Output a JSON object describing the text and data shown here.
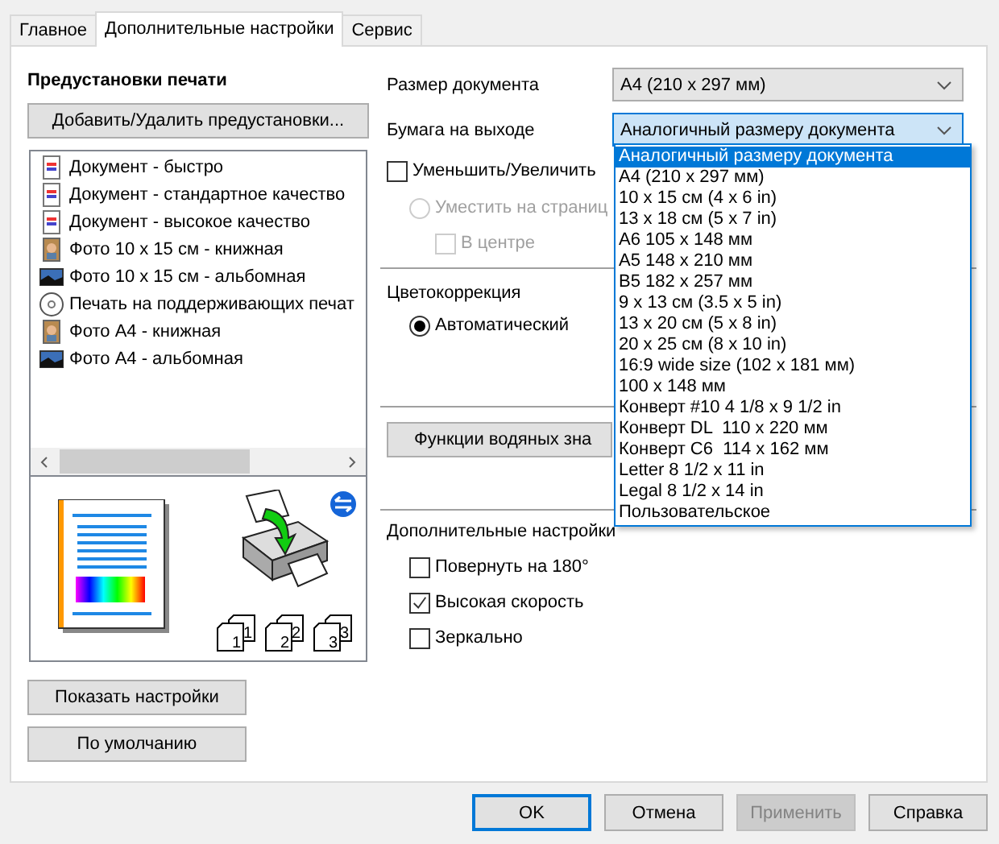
{
  "tabs": [
    {
      "label": "Главное",
      "selected": false
    },
    {
      "label": "Дополнительные настройки",
      "selected": true
    },
    {
      "label": "Сервис",
      "selected": false
    }
  ],
  "presets": {
    "title": "Предустановки печати",
    "add_button": "Добавить/Удалить предустановки...",
    "items": [
      {
        "label": "Документ - быстро",
        "kind": "doc"
      },
      {
        "label": "Документ - стандартное качество",
        "kind": "doc"
      },
      {
        "label": "Документ - высокое качество",
        "kind": "doc"
      },
      {
        "label": "Фото 10 x 15 см - книжная",
        "kind": "portrait"
      },
      {
        "label": "Фото 10 x 15 см - альбомная",
        "kind": "landscape"
      },
      {
        "label": "Печать на поддерживающих печат",
        "kind": "disc"
      },
      {
        "label": "Фото A4 - книжная",
        "kind": "portrait"
      },
      {
        "label": "Фото A4 - альбомная",
        "kind": "landscape"
      }
    ]
  },
  "preview": {
    "collate": [
      {
        "front": "1",
        "back": "1"
      },
      {
        "front": "2",
        "back": "2"
      },
      {
        "front": "3",
        "back": "3"
      }
    ]
  },
  "left_buttons": [
    "Показать настройки",
    "По умолчанию"
  ],
  "document_size": {
    "label": "Размер документа",
    "value": "A4 (210 x 297 мм)"
  },
  "output_paper": {
    "label": "Бумага на выходе",
    "value": "Аналогичный размеру документа",
    "expanded": true,
    "options": [
      {
        "label": "Аналогичный размеру документа",
        "selected": true
      },
      {
        "label": "A4 (210 x 297 мм)",
        "selected": false
      },
      {
        "label": "10 x 15 см (4 x 6 in)",
        "selected": false
      },
      {
        "label": "13 x 18 см (5 x 7 in)",
        "selected": false
      },
      {
        "label": "A6 105 x 148 мм",
        "selected": false
      },
      {
        "label": "A5 148 x 210 мм",
        "selected": false
      },
      {
        "label": "B5 182 x 257 мм",
        "selected": false
      },
      {
        "label": "9 x 13 см (3.5 x 5 in)",
        "selected": false
      },
      {
        "label": "13 x 20 см (5 x 8 in)",
        "selected": false
      },
      {
        "label": "20 x 25 см (8 x 10 in)",
        "selected": false
      },
      {
        "label": "16:9 wide size (102 x 181 мм)",
        "selected": false
      },
      {
        "label": "100 x 148 мм",
        "selected": false
      },
      {
        "label": "Конверт #10 4 1/8 x 9 1/2 in",
        "selected": false
      },
      {
        "label": "Конверт DL  110 x 220 мм",
        "selected": false
      },
      {
        "label": "Конверт C6  114 x 162 мм",
        "selected": false
      },
      {
        "label": "Letter 8 1/2 x 11 in",
        "selected": false
      },
      {
        "label": "Legal 8 1/2 x 14 in",
        "selected": false
      },
      {
        "label": "Пользовательское",
        "selected": false
      }
    ]
  },
  "reduce_enlarge": {
    "label": "Уменьшить/Увеличить",
    "checked": false
  },
  "fit_page": {
    "label": "Уместить на страниц",
    "selected": false,
    "disabled": true
  },
  "center": {
    "label": "В центре",
    "checked": false,
    "disabled": true
  },
  "color": {
    "title": "Цветокоррекция",
    "options": [
      {
        "label": "Автоматический",
        "selected": true
      }
    ]
  },
  "watermark_button": "Функции водяных зна",
  "extra": {
    "title": "Дополнительные настройки",
    "options": [
      {
        "label": "Повернуть на 180°",
        "checked": false
      },
      {
        "label": "Высокая скорость",
        "checked": true
      },
      {
        "label": "Зеркально",
        "checked": false
      }
    ]
  },
  "buttons": [
    {
      "label": "OK",
      "default": true,
      "disabled": false
    },
    {
      "label": "Отмена",
      "default": false,
      "disabled": false
    },
    {
      "label": "Применить",
      "default": false,
      "disabled": true
    },
    {
      "label": "Справка",
      "default": false,
      "disabled": false
    }
  ]
}
